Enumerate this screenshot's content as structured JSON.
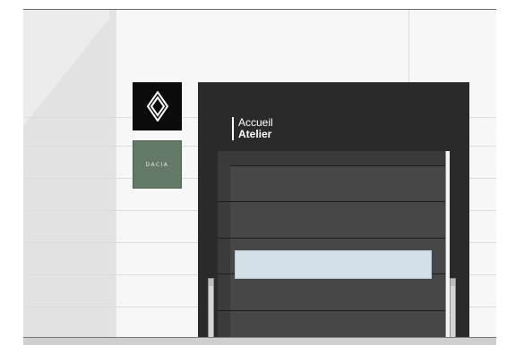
{
  "header_label": {
    "line1": "Accueil",
    "line2": "Atelier"
  },
  "signs": {
    "renault_logo": "renault-diamond-logo",
    "dacia_logo_text": "DACIA"
  },
  "colors": {
    "building": "#2a2a2a",
    "door": "#474747",
    "window": "#d3e0ea",
    "dacia_sign": "#647966",
    "renault_sign": "#0b0b0b"
  }
}
